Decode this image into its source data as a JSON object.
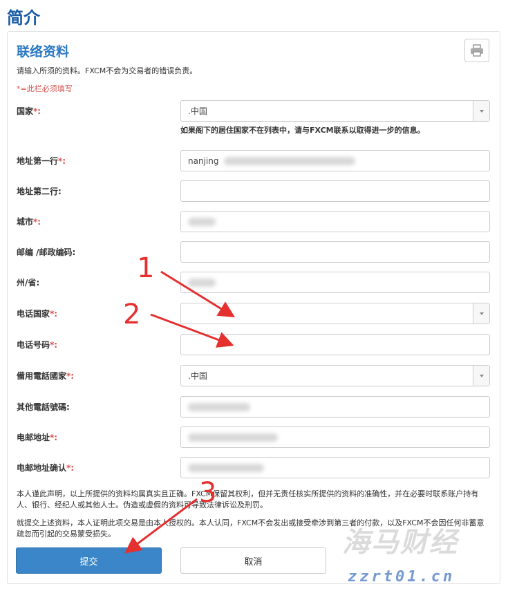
{
  "page_title": "简介",
  "section": {
    "title": "联络资料",
    "intro": "请输入所须的资料。FXCM不会为交易者的错误负责。",
    "required_note": "*=此栏必须填写"
  },
  "fields": {
    "country": {
      "label": "国家",
      "req": "*:",
      "value": ".中国",
      "note": "如果阁下的居住国家不在列表中，请与FXCM联系以取得进一步的信息。"
    },
    "address1": {
      "label": "地址第一行",
      "req": "*:",
      "value": "nanjing"
    },
    "address2": {
      "label": "地址第二行:",
      "value": ""
    },
    "city": {
      "label": "城市",
      "req": "*:"
    },
    "postcode": {
      "label": "邮编 /邮政编码:",
      "value": ""
    },
    "state": {
      "label": "州/省:"
    },
    "phone_country": {
      "label": "电话国家",
      "req": "*:",
      "value": ""
    },
    "phone": {
      "label": "电话号码",
      "req": "*:",
      "value": ""
    },
    "alt_phone_country": {
      "label": "備用電話國家",
      "req": "*:",
      "value": ".中国"
    },
    "other_phone": {
      "label": "其他電話號碼:"
    },
    "email": {
      "label": "电邮地址",
      "req": "*:"
    },
    "email_confirm": {
      "label": "电邮地址确认",
      "req": "*:"
    }
  },
  "disclaimer": {
    "p1": "本人谨此声明，以上所提供的资料均属真实且正确。FXCM保留其权利，但并无责任核实所提供的资料的准确性，并在必要时联系账户持有人、银行、经纪人或其他人士。伪造或虚假的资料可导致法律诉讼及刑罚。",
    "p2": "就提交上述资料，本人证明此项交易是由本人授权的。本人认同，FXCM不会发出或接受牵涉到第三者的付款，以及FXCM不会因任何非蓄意疏忽而引起的交易蒙受损失。"
  },
  "buttons": {
    "submit": "提交",
    "cancel": "取消"
  },
  "annotations": {
    "n1": "1",
    "n2": "2",
    "n3": "3"
  },
  "watermark": {
    "brand": "海马财经",
    "url": "zzrt01.cn"
  },
  "colors": {
    "title_blue": "#1a5da6",
    "section_blue": "#2a78c2",
    "required_red": "#d9534f",
    "submit_blue": "#3a86c8",
    "annotation_red": "#e53030"
  }
}
